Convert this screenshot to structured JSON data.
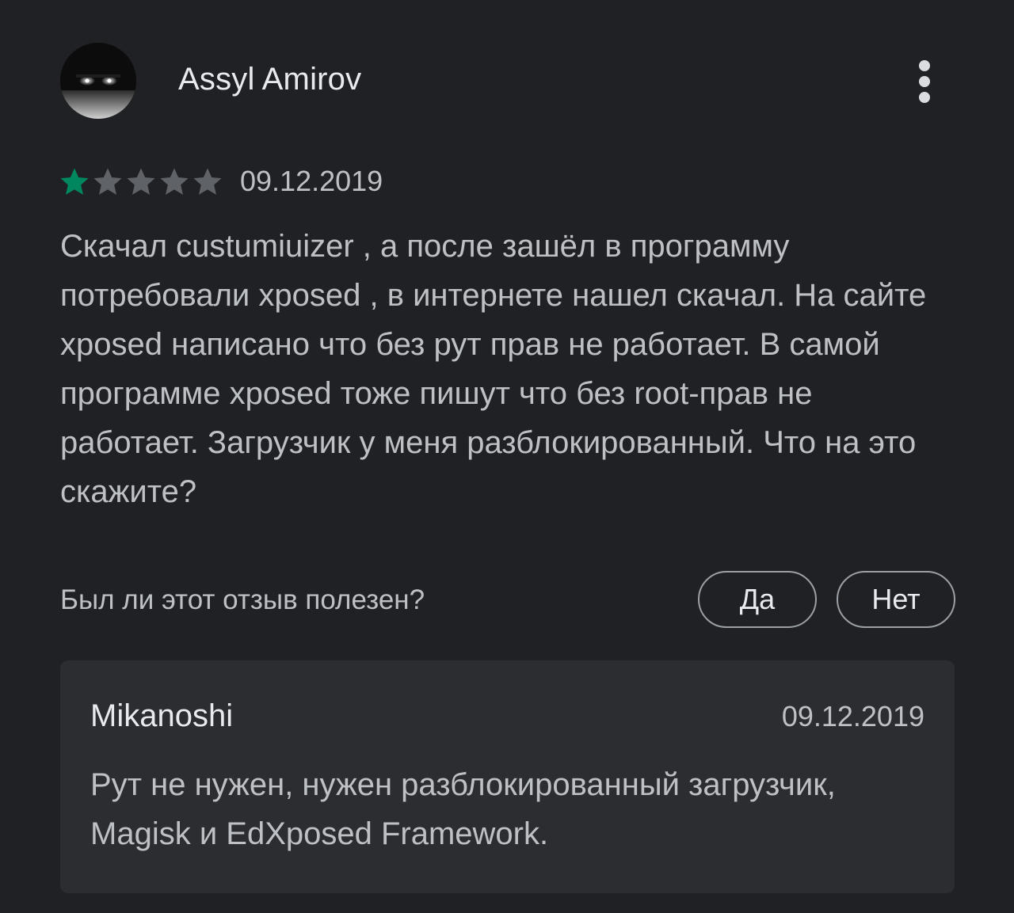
{
  "review": {
    "author": "Assyl Amirov",
    "rating": 1,
    "rating_max": 5,
    "date": "09.12.2019",
    "text": "Скачал custumiuizer , а после зашёл в программу потребовали xposed , в интернете нашел скачал. На сайте xposed написано что без рут прав не работает. В самой программе xposed тоже пишут что без root-прав не работает. Загрузчик у меня разблокированный. Что на это скажите?"
  },
  "helpful": {
    "question": "Был ли этот отзыв полезен?",
    "yes_label": "Да",
    "no_label": "Нет"
  },
  "reply": {
    "author": "Mikanoshi",
    "date": "09.12.2019",
    "text": "Рут не нужен, нужен разблокированный загрузчик, Magisk и EdXposed Framework."
  },
  "icons": {
    "more": "more-vert-icon",
    "star": "star-icon"
  },
  "colors": {
    "background": "#202124",
    "star_filled": "#01875f",
    "star_empty": "#5f6368",
    "card": "#2c2d31"
  }
}
